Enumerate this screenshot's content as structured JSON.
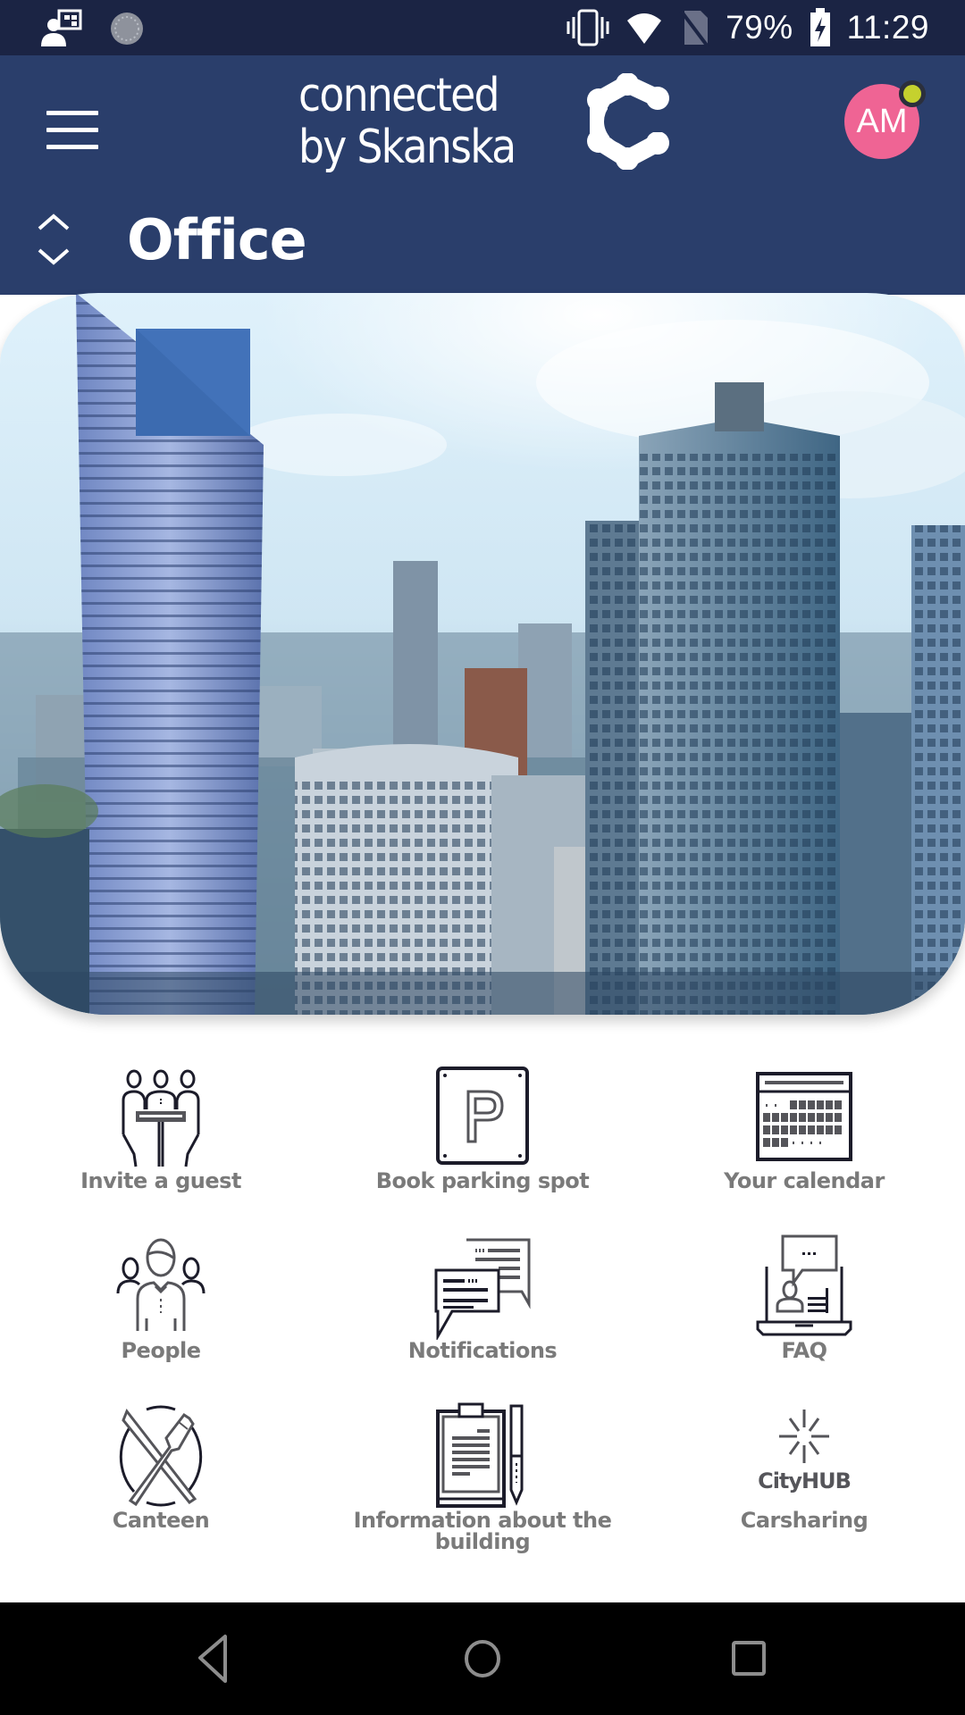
{
  "status_bar": {
    "battery": "79%",
    "time": "11:29",
    "icons": [
      "profile-notification-icon",
      "sync-icon",
      "vibrate-icon",
      "wifi-icon",
      "no-sim-icon",
      "battery-charging-icon"
    ]
  },
  "header": {
    "menu_icon": "hamburger-icon",
    "brand_line1": "connected",
    "brand_line2": "by Skanska",
    "logo_icon": "skanska-c-logo-icon",
    "avatar_initials": "AM",
    "avatar_color": "#ef6494",
    "avatar_status_color": "#c5d12e",
    "location_switch_icon": "chevron-up-down-icon",
    "location_title": "Office"
  },
  "hero": {
    "image_description": "Aerial view of Warsaw skyline with glass skyscrapers"
  },
  "tiles": [
    {
      "label": "Invite a guest",
      "icon": "meeting-guests-icon"
    },
    {
      "label": "Book parking spot",
      "icon": "parking-icon"
    },
    {
      "label": "Your calendar",
      "icon": "calendar-icon"
    },
    {
      "label": "People",
      "icon": "people-icon"
    },
    {
      "label": "Notifications",
      "icon": "chat-bubbles-icon"
    },
    {
      "label": "FAQ",
      "icon": "laptop-faq-icon"
    },
    {
      "label": "Canteen",
      "icon": "knife-fork-icon"
    },
    {
      "label": "Information about the building",
      "icon": "clipboard-pen-icon"
    },
    {
      "label": "Carsharing",
      "icon": "cityhub-icon",
      "icon_text": "CityHUB"
    }
  ],
  "nav_bar": {
    "back": "back-icon",
    "home": "home-icon",
    "recents": "recents-icon"
  },
  "colors": {
    "status_bar": "#1b2444",
    "header": "#2a3e6b",
    "tile_label": "#7a7a7a",
    "icon_stroke": "#1c1c2a"
  }
}
